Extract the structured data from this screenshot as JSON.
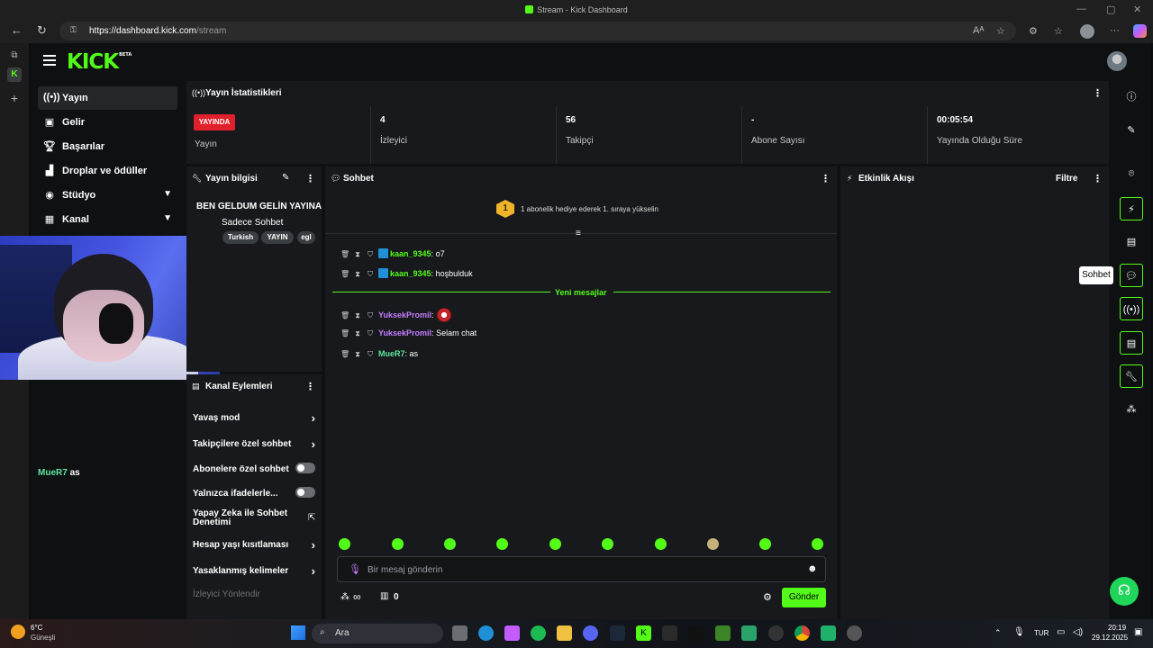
{
  "browser": {
    "tab_title": "Stream - Kick Dashboard",
    "url_host": "https://dashboard.kick.com",
    "url_path": "/stream"
  },
  "header": {
    "logo": "KICK",
    "logo_badge": "BETA"
  },
  "sidebar": {
    "items": [
      {
        "label": "Yayın",
        "icon": "broadcast-icon"
      },
      {
        "label": "Gelir",
        "icon": "wallet-icon"
      },
      {
        "label": "Başarılar",
        "icon": "trophy-icon"
      },
      {
        "label": "Droplar ve ödüller",
        "icon": "gift-icon"
      },
      {
        "label": "Stüdyo",
        "icon": "camera-icon"
      },
      {
        "label": "Kanal",
        "icon": "users-icon"
      }
    ]
  },
  "webcam_chat": {
    "user": "MueR7",
    "text": "as"
  },
  "stats": {
    "title": "Yayın İstatistikleri",
    "live_badge": "YAYINDA",
    "items": [
      {
        "value": "",
        "label": "Yayın"
      },
      {
        "value": "4",
        "label": "İzleyici"
      },
      {
        "value": "56",
        "label": "Takipçi"
      },
      {
        "value": "-",
        "label": "Abone Sayısı"
      },
      {
        "value": "00:05:54",
        "label": "Yayında Olduğu Süre"
      }
    ]
  },
  "stream_info": {
    "title": "Yayın bilgisi",
    "stream_title": "BEN GELDUM GELİN YAYINA",
    "category": "Sadece Sohbet",
    "tags": [
      "Turkish",
      "YAYIN",
      "egl"
    ]
  },
  "channel_actions": {
    "title": "Kanal Eylemleri",
    "rows": [
      {
        "label": "Yavaş mod",
        "type": "chevron"
      },
      {
        "label": "Takipçilere özel sohbet",
        "type": "chevron"
      },
      {
        "label": "Abonelere özel sohbet",
        "type": "toggle"
      },
      {
        "label": "Yalnızca ifadelerle...",
        "type": "toggle"
      },
      {
        "label": "Yapay Zeka ile Sohbet Denetimi",
        "type": "external"
      },
      {
        "label": "Hesap yaşı kısıtlaması",
        "type": "chevron"
      },
      {
        "label": "Yasaklanmış kelimeler",
        "type": "chevron"
      },
      {
        "label": "İzleyici Yönlendir",
        "type": "disabled"
      }
    ]
  },
  "chat": {
    "title": "Sohbet",
    "promo_number": "1",
    "promo_text": "1 abonelik hediye ederek 1. sıraya yükselin",
    "divider": "Yeni mesajlar",
    "messages": [
      {
        "user": "kaan_9345",
        "text": "o7",
        "color": "#53fc18",
        "badge": true
      },
      {
        "user": "kaan_9345",
        "text": "hoşbulduk",
        "color": "#53fc18",
        "badge": true
      },
      {
        "user": "YuksekPromil",
        "text": "",
        "color": "#c77dff",
        "badge": false,
        "emote": true
      },
      {
        "user": "YuksekPromil",
        "text": "Selam chat",
        "color": "#c77dff",
        "badge": false
      },
      {
        "user": "MueR7",
        "text": "as",
        "color": "#5ee6a0",
        "badge": false
      }
    ],
    "placeholder": "Bir mesaj gönderin",
    "points": "∞",
    "gift_count": "0",
    "send_label": "Gönder"
  },
  "activity": {
    "title": "Etkinlik Akışı",
    "filter_label": "Filtre"
  },
  "right_rail": {
    "tooltip": "Sohbet"
  },
  "taskbar": {
    "weather_temp": "6°C",
    "weather_desc": "Güneşli",
    "search_label": "Ara",
    "lang": "TUR",
    "time": "20:19",
    "date": "29.12.2025"
  },
  "colors": {
    "accent": "#53fc18",
    "live": "#e0202a"
  }
}
